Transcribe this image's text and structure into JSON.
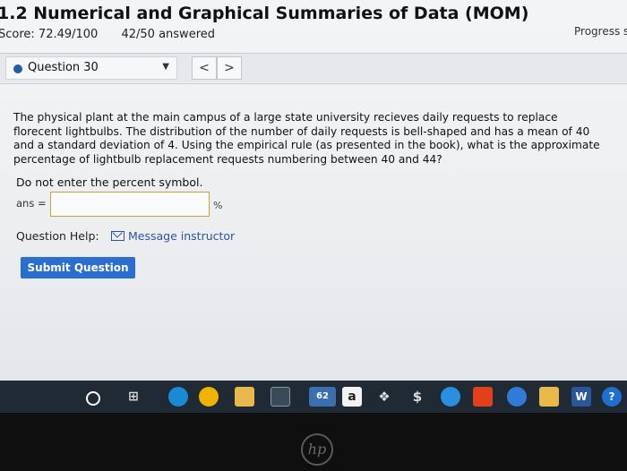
{
  "header": {
    "title": "1.2 Numerical and Graphical Summaries of Data (MOM)",
    "score": "Score: 72.49/100",
    "answered": "42/50 answered",
    "progress": "Progress s"
  },
  "question_nav": {
    "selected": "Question 30",
    "prev_label": "<",
    "next_label": ">"
  },
  "question": {
    "text": "The physical plant at the main campus of a large state university recieves daily requests to replace florecent lightbulbs. The distribution of the number of daily requests is bell-shaped and has a mean of 40 and a standard deviation of 4. Using the empirical rule (as presented in the book), what is the approximate percentage of lightbulb replacement requests numbering between 40 and 44?",
    "note": "Do not enter the percent symbol.",
    "answer_label": "ans =",
    "answer_value": "",
    "unit": "%"
  },
  "help": {
    "label": "Question Help:",
    "message_link": "Message instructor"
  },
  "actions": {
    "submit_label": "Submit Question"
  },
  "taskbar": {
    "mail_badge": "62",
    "word_label": "W",
    "help_label": "?",
    "amazon_label": "a"
  },
  "bezel": {
    "brand": "hp"
  },
  "colors": {
    "accent": "#2a6fd0",
    "link": "#2a55a6",
    "question_dot": "#1e5fa8"
  }
}
